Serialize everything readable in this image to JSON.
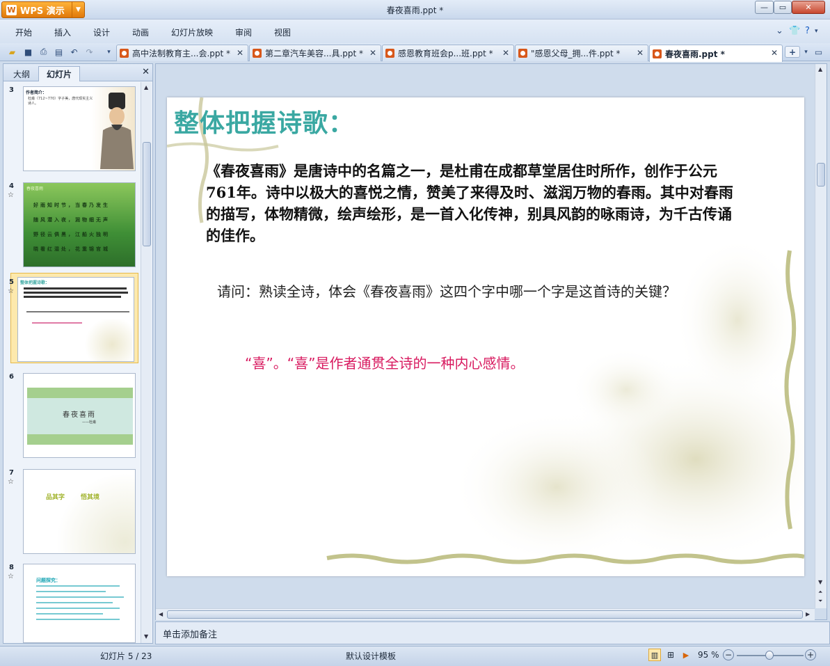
{
  "app": {
    "name": "WPS 演示",
    "logo": "W"
  },
  "window": {
    "title": "春夜喜雨.ppt *"
  },
  "menu": {
    "items": [
      "开始",
      "插入",
      "设计",
      "动画",
      "幻灯片放映",
      "审阅",
      "视图"
    ],
    "right_icons": [
      "chevron-down-icon",
      "shirt-icon",
      "help-icon"
    ]
  },
  "tabs": [
    {
      "label": "高中法制教育主...会.ppt *"
    },
    {
      "label": "第二章汽车美容...具.ppt *"
    },
    {
      "label": "感恩教育班会p...班.ppt *"
    },
    {
      "label": "\"感恩父母_拥...件.ppt *"
    },
    {
      "label": "春夜喜雨.ppt *"
    }
  ],
  "panel": {
    "tabs": [
      "大纲",
      "幻灯片"
    ],
    "active_tab": "幻灯片",
    "slides": [
      {
        "num": "3",
        "star": false,
        "heading": "作者简介：",
        "text": "杜甫（712~770）字子美，唐代现实主义诗人。"
      },
      {
        "num": "4",
        "star": true,
        "heading": "春夜喜雨",
        "lines": [
          "好雨知时节，当春乃发生",
          "随风潜入夜，润物细无声",
          "野径云俱黑，江船火独明",
          "晓看红湿处，花重锦官城"
        ]
      },
      {
        "num": "5",
        "star": true,
        "heading": "整体把握诗歌：",
        "selected": true
      },
      {
        "num": "6",
        "star": false,
        "title": "春夜喜雨",
        "author": "——杜甫"
      },
      {
        "num": "7",
        "star": true,
        "left": "品其字",
        "right": "悟其境"
      },
      {
        "num": "8",
        "star": true,
        "heading": "问题探究："
      }
    ]
  },
  "slide": {
    "title": "整体把握诗歌：",
    "body": "《春夜喜雨》是唐诗中的名篇之一，是杜甫在成都草堂居住时所作，创作于公元761年。诗中以极大的喜悦之情，赞美了来得及时、滋润万物的春雨。其中对春雨的描写，体物精微，绘声绘形，是一首入化传神，别具风韵的咏雨诗，为千古传诵的佳作。",
    "question": "请问：熟读全诗，体会《春夜喜雨》这四个字中哪一个字是这首诗的关键？",
    "answer": "“喜”。“喜”是作者通贯全诗的一种内心感情。"
  },
  "notes": {
    "placeholder": "单击添加备注"
  },
  "status": {
    "slide_counter": "幻灯片 5 / 23",
    "template": "默认设计模板",
    "zoom": "95 %",
    "zoom_level": 0.5
  },
  "colors": {
    "title_teal": "#3aa8a2",
    "answer_pink": "#d81b60",
    "selection": "#fde9ad"
  }
}
